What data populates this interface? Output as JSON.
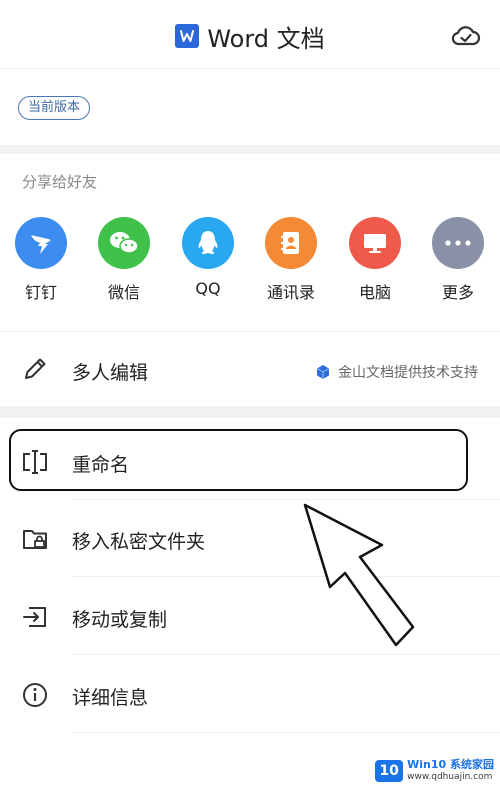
{
  "header": {
    "title": "Word 文档",
    "title_icon": "word-doc-icon",
    "cloud_icon": "cloud-check-icon"
  },
  "version": {
    "badge": "当前版本"
  },
  "share": {
    "title": "分享给好友",
    "items": [
      {
        "label": "钉钉",
        "color": "#3d8cf0",
        "icon": "dingtalk-icon"
      },
      {
        "label": "微信",
        "color": "#3fc14a",
        "icon": "wechat-icon"
      },
      {
        "label": "QQ",
        "color": "#29a7f0",
        "icon": "qq-icon"
      },
      {
        "label": "通讯录",
        "color": "#f48a36",
        "icon": "contacts-icon"
      },
      {
        "label": "电脑",
        "color": "#ef5a4b",
        "icon": "computer-icon"
      },
      {
        "label": "更多",
        "color": "#8a90a6",
        "icon": "more-icon"
      }
    ]
  },
  "collab": {
    "label": "多人编辑",
    "support": "金山文档提供技术支持"
  },
  "actions": [
    {
      "label": "重命名",
      "icon": "rename-icon"
    },
    {
      "label": "移入私密文件夹",
      "icon": "private-folder-icon"
    },
    {
      "label": "移动或复制",
      "icon": "move-copy-icon"
    },
    {
      "label": "详细信息",
      "icon": "info-icon"
    }
  ],
  "watermark": {
    "badge": "10",
    "line1": "Win10 系统家园",
    "line2": "www.qdhuajin.com"
  }
}
